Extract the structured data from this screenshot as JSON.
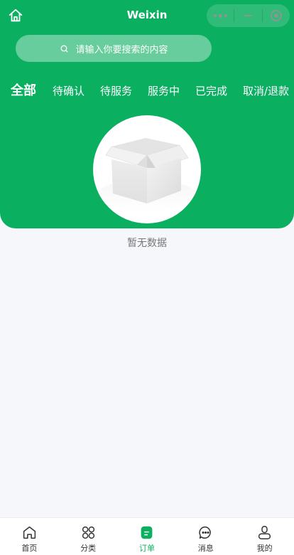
{
  "nav": {
    "title": "Weixin",
    "home_icon": "home-outline-icon",
    "capsule": [
      "more-dots-icon",
      "minimize-icon",
      "close-target-icon"
    ]
  },
  "search": {
    "placeholder": "请输入你要搜索的内容",
    "icon": "search-icon"
  },
  "tabs": [
    {
      "label": "全部",
      "active": true
    },
    {
      "label": "待确认",
      "active": false
    },
    {
      "label": "待服务",
      "active": false
    },
    {
      "label": "服务中",
      "active": false
    },
    {
      "label": "已完成",
      "active": false
    },
    {
      "label": "取消/退款",
      "active": false
    }
  ],
  "empty": {
    "image_icon": "empty-box-icon",
    "text": "暂无数据"
  },
  "tabbar": [
    {
      "label": "首页",
      "icon": "home-icon",
      "active": false
    },
    {
      "label": "分类",
      "icon": "category-grid-icon",
      "active": false
    },
    {
      "label": "订单",
      "icon": "order-icon",
      "active": true
    },
    {
      "label": "消息",
      "icon": "message-bubble-icon",
      "active": false
    },
    {
      "label": "我的",
      "icon": "profile-icon",
      "active": false
    }
  ],
  "colors": {
    "primary_green": "#0aaf60",
    "tab_underline": "#f3d837",
    "page_background": "#f6f7fb"
  }
}
